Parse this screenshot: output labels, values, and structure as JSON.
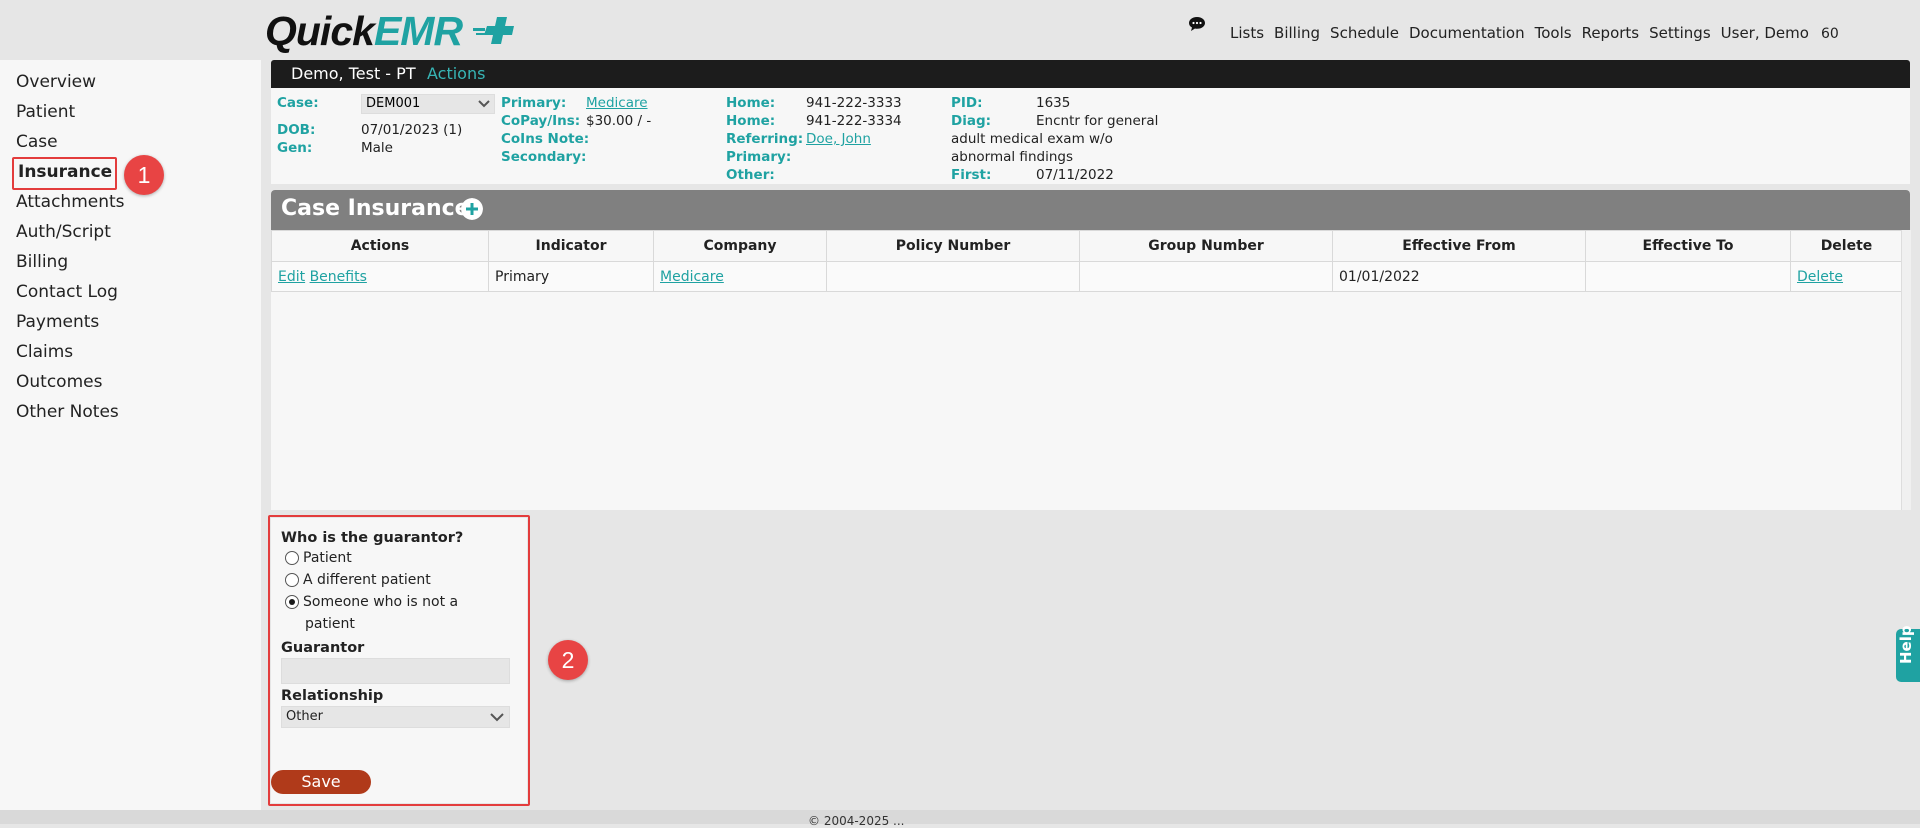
{
  "header": {
    "logo_primary": "Quick",
    "logo_accent": "EMR",
    "nav": [
      "Lists",
      "Billing",
      "Schedule",
      "Documentation",
      "Tools",
      "Reports",
      "Settings",
      "User, Demo"
    ],
    "timer": "60"
  },
  "sidebar": {
    "items": [
      "Overview",
      "Patient",
      "Case",
      "Insurance",
      "Attachments",
      "Auth/Script",
      "Billing",
      "Contact Log",
      "Payments",
      "Claims",
      "Outcomes",
      "Other Notes"
    ],
    "active": "Insurance"
  },
  "patient_bar": {
    "name": "Demo, Test - PT",
    "actions": "Actions"
  },
  "info": {
    "case_label": "Case:",
    "case_value": "DEM001",
    "dob_label": "DOB:",
    "dob_value": "07/01/2023 (1)",
    "gen_label": "Gen:",
    "gen_value": "Male",
    "primary_label": "Primary:",
    "primary_value": "Medicare",
    "copay_label": "CoPay/Ins:",
    "copay_value": "$30.00 / -",
    "coins_label": "CoIns Note:",
    "secondary_label": "Secondary:",
    "home1_label": "Home:",
    "home1_value": "941-222-3333",
    "home2_label": "Home:",
    "home2_value": "941-222-3334",
    "referring_label": "Referring:",
    "referring_value": "Doe, John",
    "primary2_label": "Primary:",
    "other_label": "Other:",
    "pid_label": "PID:",
    "pid_value": "1635",
    "diag_label": "Diag:",
    "diag_line1": "Encntr for general",
    "diag_line2": "adult medical exam w/o",
    "diag_line3": "abnormal findings",
    "first_label": "First:",
    "first_value": "07/11/2022"
  },
  "case_insurance": {
    "title": "Case Insurance",
    "columns": [
      "Actions",
      "Indicator",
      "Company",
      "Policy Number",
      "Group Number",
      "Effective From",
      "Effective To",
      "Delete"
    ],
    "rows": [
      {
        "edit": "Edit",
        "benefits": "Benefits",
        "indicator": "Primary",
        "company": "Medicare",
        "policy": "",
        "group": "",
        "from": "01/01/2022",
        "to": "",
        "delete": "Delete"
      }
    ]
  },
  "guarantor": {
    "question": "Who is the guarantor?",
    "options": [
      "Patient",
      "A different patient",
      "Someone who is not a",
      "patient"
    ],
    "selected_index": 2,
    "guarantor_label": "Guarantor",
    "guarantor_value": "",
    "relationship_label": "Relationship",
    "relationship_value": "Other",
    "save_label": "Save"
  },
  "annotations": [
    "1",
    "2"
  ],
  "help_label": "Help",
  "footer_text": "© 2004-2025 ...",
  "colors": {
    "accent": "#1fa2a2",
    "annotation": "#e84444",
    "save": "#b03a1a",
    "header_bar": "#1c1c1c"
  }
}
